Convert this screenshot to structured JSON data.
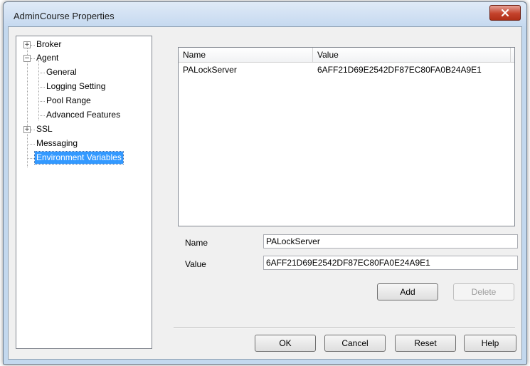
{
  "window": {
    "title": "AdminCourse Properties"
  },
  "tree": {
    "items": [
      {
        "label": "Broker",
        "toggle": "+"
      },
      {
        "label": "Agent",
        "toggle": "−"
      },
      {
        "label": "General"
      },
      {
        "label": "Logging Setting"
      },
      {
        "label": "Pool Range"
      },
      {
        "label": "Advanced Features"
      },
      {
        "label": "SSL",
        "toggle": "+"
      },
      {
        "label": "Messaging"
      },
      {
        "label": "Environment Variables",
        "selected": true
      }
    ]
  },
  "list": {
    "columns": [
      "Name",
      "Value"
    ],
    "rows": [
      {
        "name": "PALockServer",
        "value": "6AFF21D69E2542DF87EC80FA0B24A9E1"
      }
    ]
  },
  "form": {
    "name_label": "Name",
    "name_value": "PALockServer",
    "value_label": "Value",
    "value_value": "6AFF21D69E2542DF87EC80FA0E24A9E1"
  },
  "buttons": {
    "add": "Add",
    "delete": "Delete",
    "ok": "OK",
    "cancel": "Cancel",
    "reset": "Reset",
    "help": "Help"
  },
  "colors": {
    "selection": "#3399ff",
    "close_button": "#c4422c",
    "frame": "#c3d8ee"
  }
}
